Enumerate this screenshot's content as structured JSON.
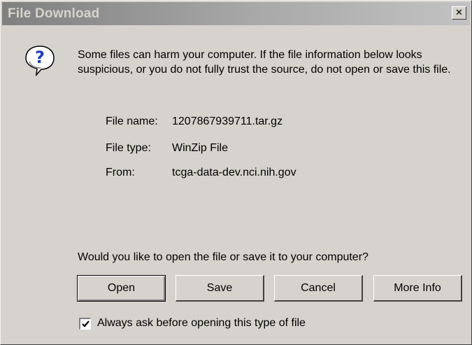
{
  "window": {
    "title": "File Download",
    "close_glyph": "✕"
  },
  "icon": {
    "name": "question-icon",
    "glyph": "?",
    "color": "#1f3fbf"
  },
  "message": {
    "warning": "Some files can harm your computer. If the file information below looks suspicious, or you do not fully trust the source, do not open or save this file.",
    "question": "Would you like to open the file or save it to your computer?"
  },
  "file_info": {
    "name_label": "File name:",
    "name_value": "1207867939711.tar.gz",
    "type_label": "File type:",
    "type_value": "WinZip File",
    "from_label": "From:",
    "from_value": "tcga-data-dev.nci.nih.gov"
  },
  "buttons": {
    "open": "Open",
    "save": "Save",
    "cancel": "Cancel",
    "more_info": "More Info"
  },
  "checkbox": {
    "label": "Always ask before opening this type of file",
    "checked": true
  },
  "colors": {
    "dialog_bg": "#d6d3ce",
    "titlebar_gradient_start": "#808080",
    "titlebar_gradient_end": "#c2c2c2"
  }
}
